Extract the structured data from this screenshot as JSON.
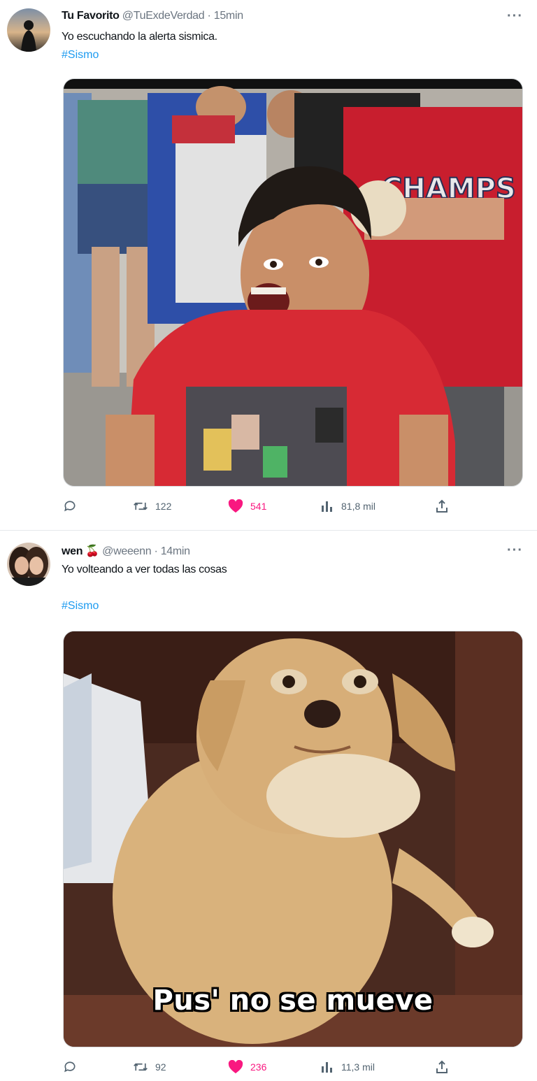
{
  "tweets": [
    {
      "author_name": "Tu Favorito",
      "handle": "@TuExdeVerdad",
      "dot": "·",
      "time": "15min",
      "text": "Yo escuchando la alerta sismica.",
      "hashtag": "#Sismo",
      "more": "···",
      "replies": "",
      "retweets": "122",
      "likes": "541",
      "views": "81,8 mil",
      "media_caption": ""
    },
    {
      "author_name": "wen",
      "author_emoji": "🍒",
      "handle": "@weeenn",
      "dot": "·",
      "time": "14min",
      "text": "Yo volteando a ver todas las cosas",
      "hashtag": "#Sismo",
      "more": "···",
      "replies": "",
      "retweets": "92",
      "likes": "236",
      "views": "11,3 mil",
      "media_caption": "Pus' no se mueve"
    }
  ],
  "colors": {
    "link": "#1d9bf0",
    "like": "#f91880",
    "muted": "#536471"
  },
  "icons": [
    "reply-icon",
    "retweet-icon",
    "heart-icon",
    "views-icon",
    "share-icon",
    "more-icon"
  ]
}
